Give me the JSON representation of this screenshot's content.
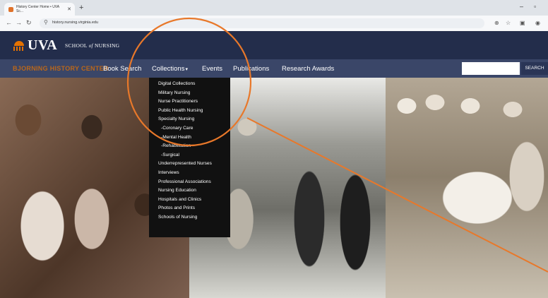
{
  "browser": {
    "tab_title": "History Center Home • UVA Sc...",
    "tab_close": "✕",
    "new_tab": "+",
    "url": "history.nursing.virginia.edu",
    "window_controls": [
      "–",
      "▫"
    ]
  },
  "header": {
    "logo_text": "UVA",
    "school_prefix": "SCHOOL",
    "school_of": "of",
    "school_suffix": "NURSING"
  },
  "nav": {
    "brand": "BJORNING HISTORY CENTER",
    "items": [
      "Book Search",
      "Collections",
      "Events",
      "Publications",
      "Research Awards"
    ],
    "collections_caret": "▾",
    "search_placeholder": "",
    "search_button": "SEARCH"
  },
  "dropdown": {
    "items": [
      {
        "label": "Digital Collections"
      },
      {
        "label": "Military Nursing"
      },
      {
        "label": "Nurse Practitioners"
      },
      {
        "label": "Public Health Nursing"
      },
      {
        "label": "Specialty Nursing"
      },
      {
        "label": "-Coronary Care"
      },
      {
        "label": "-Mental Health"
      },
      {
        "label": "-Rehabilitation"
      },
      {
        "label": "-Surgical"
      },
      {
        "label": "Underrepresented Nurses"
      },
      {
        "label": "Interviews"
      },
      {
        "label": "Professional Associations"
      },
      {
        "label": "Nursing Education"
      },
      {
        "label": "Hospitals and Clinics"
      },
      {
        "label": "Photos and Prints"
      },
      {
        "label": "Schools of Nursing"
      }
    ]
  },
  "colors": {
    "header_navy": "#232d4b",
    "nav_bar": "#3a4668",
    "brand_orange": "#e57200",
    "annotation": "#e8782a"
  }
}
